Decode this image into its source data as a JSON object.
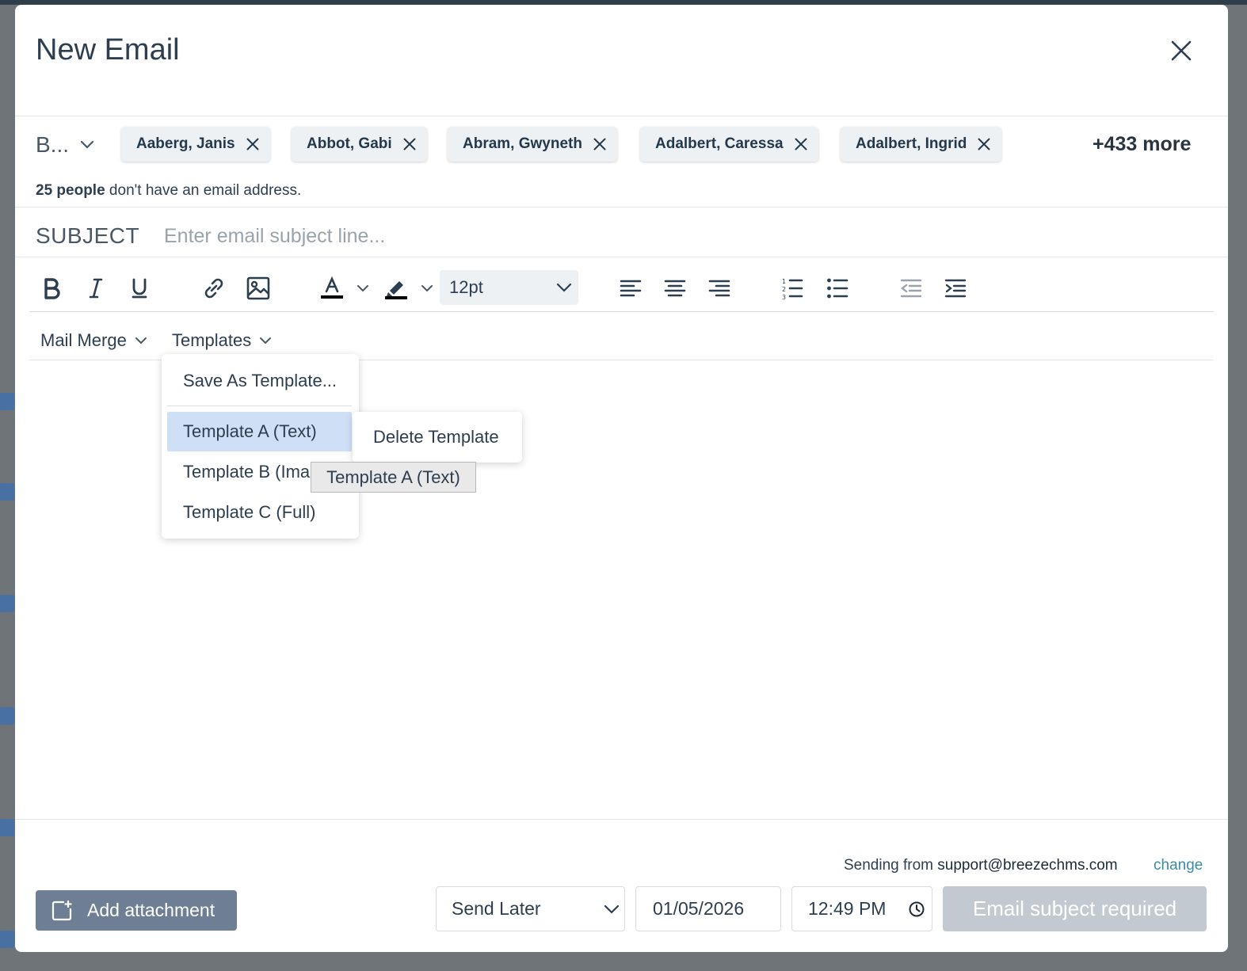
{
  "modal": {
    "title": "New Email"
  },
  "recipients": {
    "selector_label": "B...",
    "chips": [
      {
        "name": "Aaberg, Janis"
      },
      {
        "name": "Abbot, Gabi"
      },
      {
        "name": "Abram, Gwyneth"
      },
      {
        "name": "Adalbert, Caressa"
      },
      {
        "name": "Adalbert, Ingrid"
      }
    ],
    "more": "+433 more",
    "no_email_count": "25 people",
    "no_email_text": " don't have an email address."
  },
  "subject": {
    "label": "SUBJECT",
    "placeholder": "Enter email subject line...",
    "value": ""
  },
  "toolbar": {
    "font_size": "12pt",
    "icons": [
      "bold-icon",
      "italic-icon",
      "underline-icon",
      "link-icon",
      "image-icon",
      "text-color-icon",
      "highlight-icon",
      "align-left-icon",
      "align-center-icon",
      "align-right-icon",
      "numbered-list-icon",
      "bullet-list-icon",
      "outdent-icon",
      "indent-icon"
    ],
    "text_color": "#000000",
    "highlight_color": "#000000"
  },
  "menus": {
    "mail_merge": "Mail Merge",
    "templates": "Templates"
  },
  "templates_dropdown": {
    "save_as": "Save As Template...",
    "items": [
      {
        "label": "Template A (Text)",
        "active": true
      },
      {
        "label": "Template B (Image)",
        "active": false
      },
      {
        "label": "Template C (Full)",
        "active": false
      }
    ]
  },
  "submenu": {
    "delete": "Delete Template"
  },
  "tooltip": {
    "text": "Template A (Text)"
  },
  "footer": {
    "sending_from_label": "Sending from ",
    "sending_from_address": "support@breezechms.com",
    "change": "change",
    "attachment": "Add attachment",
    "send_mode": "Send Later",
    "date": "01/05/2026",
    "time": "12:49 PM",
    "submit": "Email subject required"
  },
  "colors": {
    "accent_link": "#3b8ba5",
    "attach_button": "#6e7f95",
    "disabled_button": "#c2c9d0",
    "menu_highlight": "#cfe0f6"
  }
}
